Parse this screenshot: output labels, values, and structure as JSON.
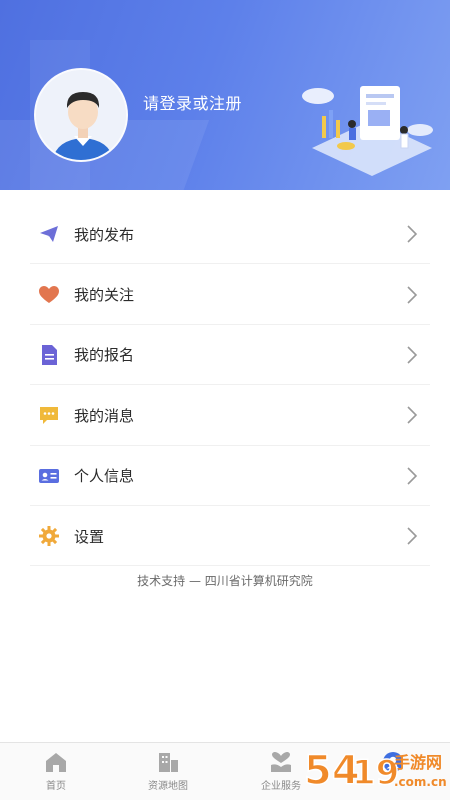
{
  "header": {
    "login_prompt": "请登录或注册",
    "avatar": "avatar-default",
    "accent": "#5a7ae6"
  },
  "menu": {
    "items": [
      {
        "label": "我的发布",
        "icon": "paper-plane-icon",
        "color": "#6d6fd8"
      },
      {
        "label": "我的关注",
        "icon": "heart-icon",
        "color": "#e2764f"
      },
      {
        "label": "我的报名",
        "icon": "document-icon",
        "color": "#6b63d6"
      },
      {
        "label": "我的消息",
        "icon": "message-icon",
        "color": "#f0b93a"
      },
      {
        "label": "个人信息",
        "icon": "id-card-icon",
        "color": "#5a6ee0"
      },
      {
        "label": "设置",
        "icon": "gear-icon",
        "color": "#f0a93a"
      }
    ]
  },
  "footer_note": "技术支持 — 四川省计算机研究院",
  "tabbar": {
    "tabs": [
      {
        "label": "首页",
        "icon": "home-icon"
      },
      {
        "label": "资源地图",
        "icon": "building-icon"
      },
      {
        "label": "企业服务",
        "icon": "service-icon"
      },
      {
        "label": "",
        "icon": "profile-icon",
        "active": true
      }
    ]
  },
  "watermark": {
    "text": "54...",
    "sub": "手游网",
    "domain": ".com.cn"
  }
}
